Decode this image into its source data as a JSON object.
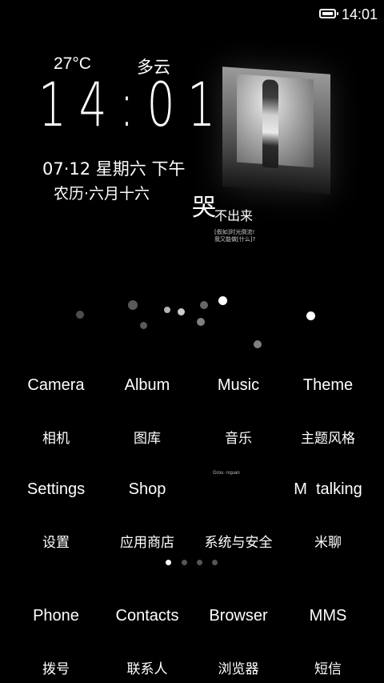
{
  "status_bar": {
    "time": "14:01",
    "battery_icon": "battery-icon"
  },
  "weather": {
    "temperature": "27°C",
    "condition": "多云"
  },
  "clock": {
    "time": "14:01",
    "date": "07·12 星期六 下午",
    "lunar": "农历·六月十六"
  },
  "wallpaper": {
    "quote_main": "哭",
    "quote_sub": "不出来",
    "quote_small_1": "[假如]时光倒流!",
    "quote_small_2": "我又能做[什么]?"
  },
  "apps_page": [
    {
      "en": "Camera",
      "zh": "相机"
    },
    {
      "en": "Album",
      "zh": "图库"
    },
    {
      "en": "Music",
      "zh": "音乐"
    },
    {
      "en": "Theme",
      "zh": "主题风格"
    },
    {
      "en": "Settings",
      "zh": "设置"
    },
    {
      "en": "Shop",
      "zh": "应用商店"
    },
    {
      "en": "",
      "zh": "系统与安全"
    },
    {
      "en": "M  talking",
      "zh": "米聊"
    }
  ],
  "dock": [
    {
      "en": "Phone",
      "zh": "拨号"
    },
    {
      "en": "Contacts",
      "zh": "联系人"
    },
    {
      "en": "Browser",
      "zh": "浏览器"
    },
    {
      "en": "MMS",
      "zh": "短信"
    }
  ],
  "page_indicator": {
    "total": 4,
    "active": 1
  },
  "tiny_label": "Grou·    nquan",
  "colors": {
    "background": "#000000",
    "text": "#ffffff",
    "dot_inactive": "#555555"
  }
}
